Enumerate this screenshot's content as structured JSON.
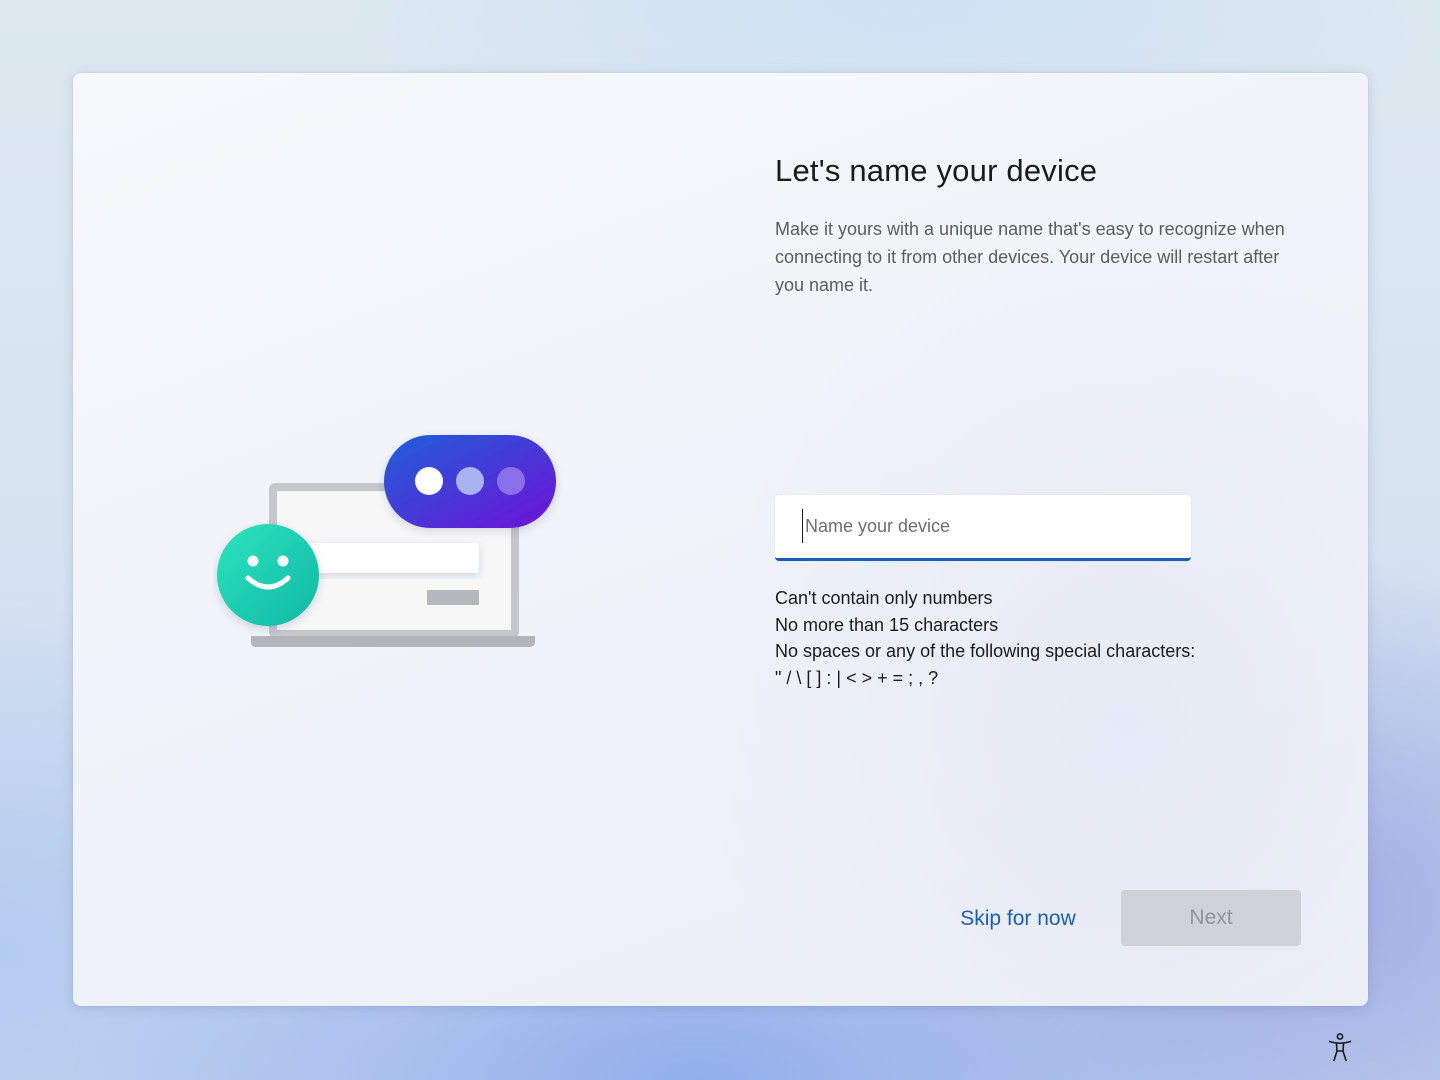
{
  "page": {
    "title": "Let's name your device",
    "description": "Make it yours with a unique name that's easy to recognize when connecting to it from other devices. Your device will restart after you name it."
  },
  "name_input": {
    "placeholder": "Name your device",
    "value": ""
  },
  "rules": [
    "Can't contain only numbers",
    "No more than 15 characters",
    "No spaces or any of the following special characters:",
    "\" / \\ [ ] : | < > + = ; , ?"
  ],
  "actions": {
    "skip_label": "Skip for now",
    "next_label": "Next"
  },
  "icons": {
    "illustration": "laptop-chat-smiley-illustration",
    "accessibility": "accessibility-icon"
  },
  "colors": {
    "accent": "#1a5fb4",
    "bubble_start": "#2563d6",
    "bubble_end": "#6a11d8",
    "smiley": "#1ccfb0",
    "disabled_button": "#cfd2d8"
  }
}
